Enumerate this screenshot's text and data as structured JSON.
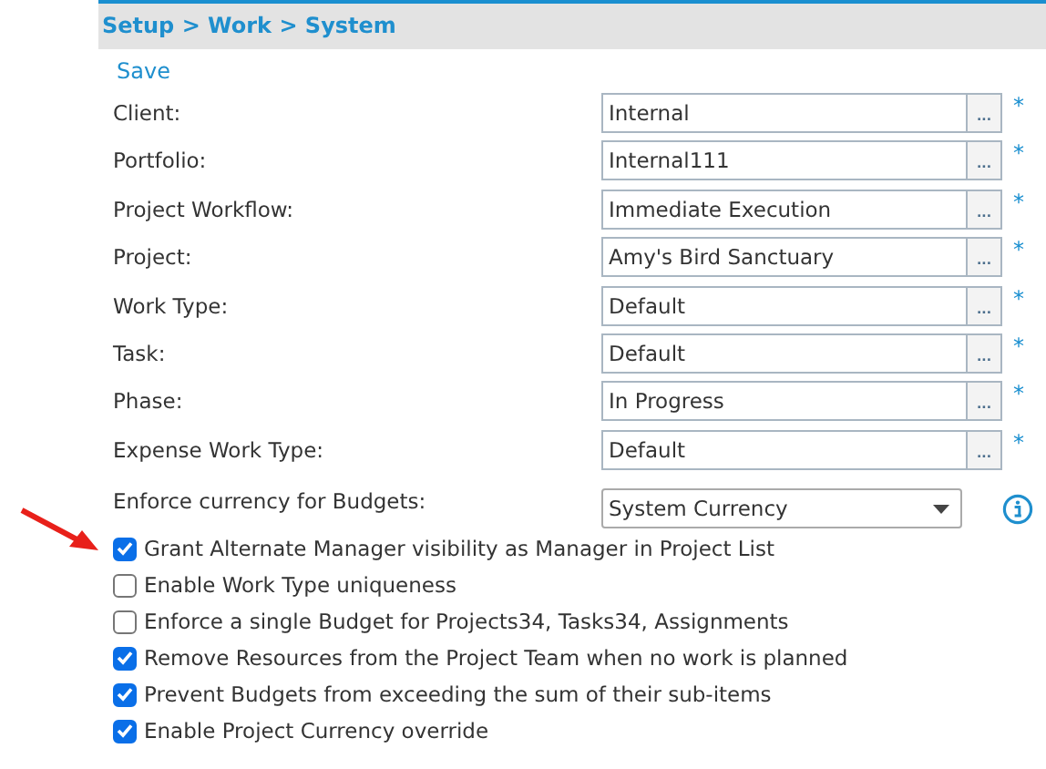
{
  "breadcrumb": "Setup > Work > System",
  "save_link": "Save",
  "fields": [
    {
      "label": "Client:",
      "value": "Internal",
      "picker": "...",
      "required_mark": "*"
    },
    {
      "label": "Portfolio:",
      "value": "Internal111",
      "picker": "...",
      "required_mark": "*"
    },
    {
      "label": "Project Workflow:",
      "value": "Immediate Execution",
      "picker": "...",
      "required_mark": "*"
    },
    {
      "label": "Project:",
      "value": "Amy's Bird Sanctuary",
      "picker": "...",
      "required_mark": "*"
    },
    {
      "label": "Work Type:",
      "value": "Default",
      "picker": "...",
      "required_mark": "*"
    },
    {
      "label": "Task:",
      "value": "Default",
      "picker": "...",
      "required_mark": "*"
    },
    {
      "label": "Phase:",
      "value": "In Progress",
      "picker": "...",
      "required_mark": "*"
    },
    {
      "label": "Expense Work Type:",
      "value": "Default",
      "picker": "...",
      "required_mark": "*"
    }
  ],
  "currency": {
    "label": "Enforce currency for Budgets:",
    "value": "System Currency"
  },
  "options": [
    {
      "label": "Grant Alternate Manager visibility as Manager in Project List",
      "checked": true
    },
    {
      "label": "Enable Work Type uniqueness",
      "checked": false
    },
    {
      "label": "Enforce a single Budget for Projects34, Tasks34, Assignments",
      "checked": false
    },
    {
      "label": "Remove Resources from the Project Team when no work is planned",
      "checked": true
    },
    {
      "label": "Prevent Budgets from exceeding the sum of their sub-items",
      "checked": true
    },
    {
      "label": "Enable Project Currency override",
      "checked": true
    }
  ]
}
